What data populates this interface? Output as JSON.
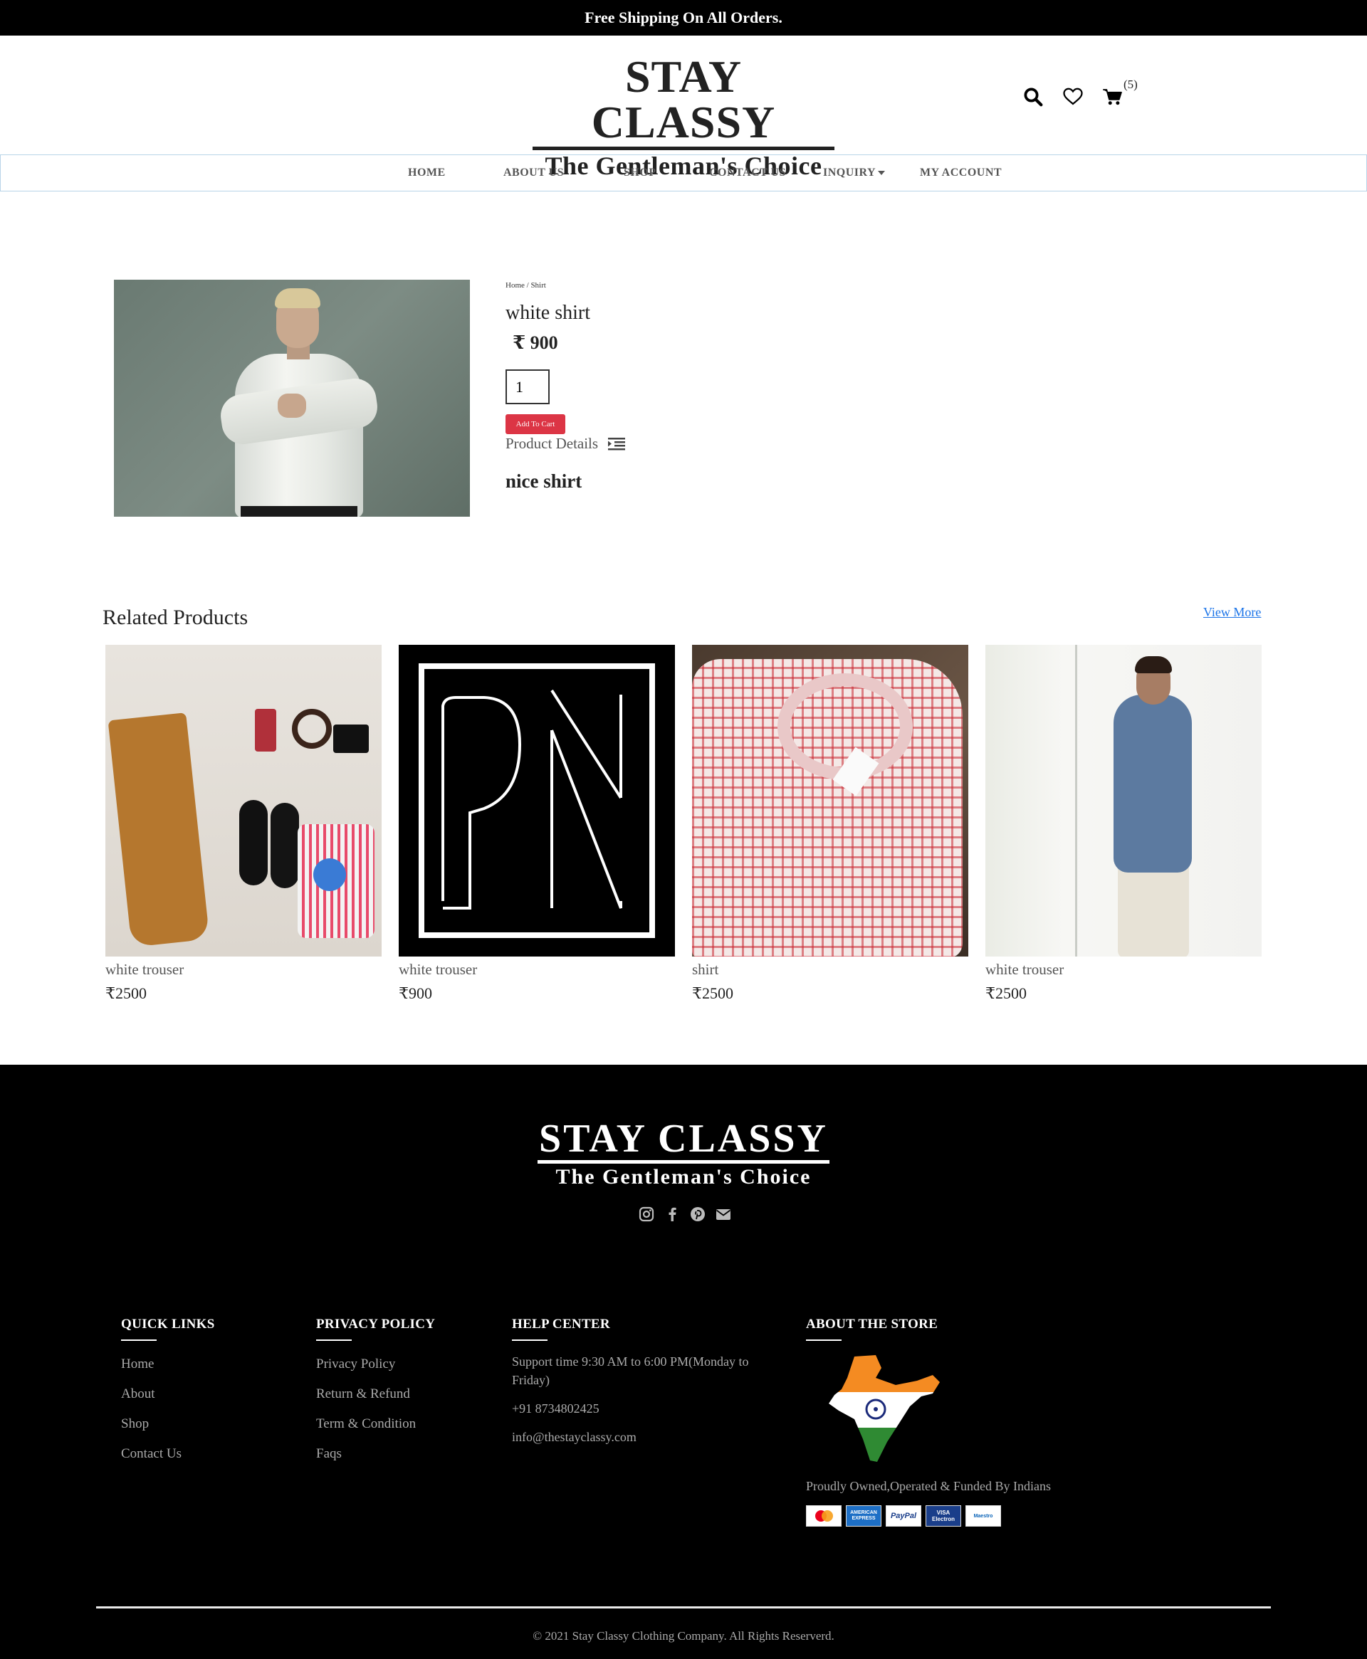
{
  "topbar": {
    "text": "Free Shipping On All Orders."
  },
  "header": {
    "logo_title": "STAY CLASSY",
    "logo_subtitle": "The Gentleman's Choice",
    "cart_count": "(5)"
  },
  "nav": {
    "items": [
      {
        "label": "HOME"
      },
      {
        "label": "ABOUT US"
      },
      {
        "label": "SHOP"
      },
      {
        "label": "CONTACT US"
      },
      {
        "label": "INQUIRY"
      },
      {
        "label": "MY ACCOUNT"
      }
    ]
  },
  "product": {
    "breadcrumb": "Home / Shirt",
    "title": "white shirt",
    "price": "₹ 900",
    "quantity": "1",
    "add_to_cart_label": "Add To Cart",
    "details_label": "Product Details",
    "details_text": "nice shirt"
  },
  "related": {
    "title": "Related Products",
    "view_more": "View More",
    "items": [
      {
        "name": "white trouser",
        "price": "₹2500"
      },
      {
        "name": "white trouser",
        "price": "₹900",
        "image_text": "PN"
      },
      {
        "name": "shirt",
        "price": "₹2500"
      },
      {
        "name": "white trouser",
        "price": "₹2500"
      }
    ]
  },
  "footer": {
    "logo_title": "STAY CLASSY",
    "logo_subtitle": "The Gentleman's Choice",
    "quick_links": {
      "heading": "QUICK LINKS",
      "links": [
        "Home",
        "About",
        "Shop",
        "Contact Us"
      ]
    },
    "privacy_policy": {
      "heading": "PRIVACY POLICY",
      "links": [
        "Privacy Policy",
        "Return & Refund",
        "Term & Condition",
        "Faqs"
      ]
    },
    "help_center": {
      "heading": "HELP CENTER",
      "support_time": "Support time 9:30 AM to 6:00 PM(Monday to Friday)",
      "phone": "+91 8734802425",
      "email": "info@thestayclassy.com"
    },
    "about_store": {
      "heading": "ABOUT THE STORE",
      "text": "Proudly Owned,Operated & Funded By Indians",
      "payment_methods": [
        "MasterCard",
        "AMERICAN EXPRESS",
        "PayPal",
        "VISA Electron",
        "Maestro"
      ]
    },
    "copyright": "© 2021 Stay Classy Clothing Company. All Rights Reserverd."
  }
}
